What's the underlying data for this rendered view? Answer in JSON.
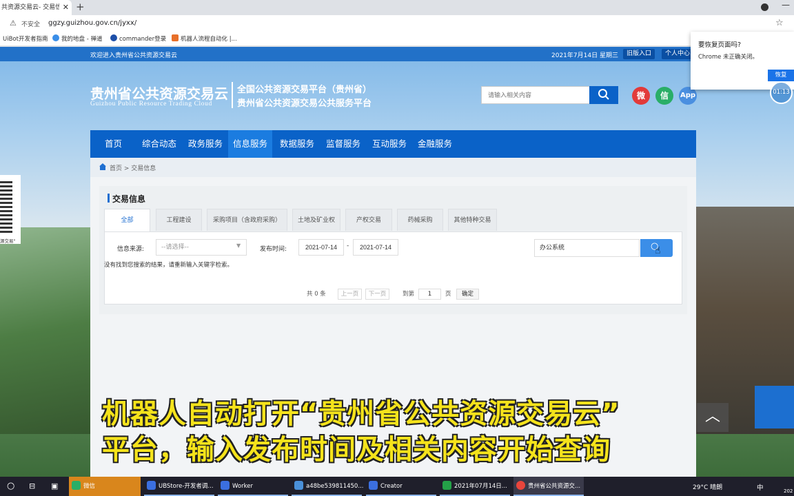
{
  "browser": {
    "tab_title": "共资源交易云- 交易信息",
    "tab_close": "✕",
    "new_tab": "+",
    "minimize": "—",
    "security_label": "不安全",
    "url": "ggzy.guizhou.gov.cn/jyxx/",
    "bookmarks": [
      {
        "label": "UiBot开发者指南",
        "color": "#ffffff"
      },
      {
        "label": "我的地盘 - 禅道",
        "color": "#3a8ee8"
      },
      {
        "label": "commander登录",
        "color": "#1d4fa8"
      },
      {
        "label": "机器人流程自动化 |...",
        "color": "#e8702a"
      }
    ]
  },
  "restore_popup": {
    "title": "要恢复页面吗?",
    "text": "Chrome 未正确关闭。",
    "button": "恢复",
    "timer": "01:13"
  },
  "header": {
    "welcome": "欢迎进入贵州省公共资源交易云",
    "date": "2021年7月14日",
    "weekday": "星期三",
    "old_entry": "旧版入口",
    "personal_center": "个人中心",
    "logo_cn": "贵州省公共资源交易云",
    "logo_en": "Guizhou Public Resource Trading Cloud",
    "platform_line1": "全国公共资源交易平台（贵州省）",
    "platform_line2": "贵州省公共资源交易公共服务平台",
    "search_placeholder": "请输入相关内容",
    "social": {
      "weibo": "微",
      "wechat": "信",
      "app": "App"
    }
  },
  "nav": {
    "items": [
      "首页",
      "综合动态",
      "政务服务",
      "信息服务",
      "数据服务",
      "监督服务",
      "互动服务",
      "金融服务"
    ],
    "active": "信息服务"
  },
  "breadcrumb": "首页 > 交易信息",
  "panel": {
    "title": "交易信息",
    "tabs": [
      "全部",
      "工程建设",
      "采购项目（含政府采购）",
      "土地及矿业权",
      "产权交易",
      "药械采购",
      "其他特种交易"
    ],
    "active_tab": "全部",
    "source_label": "信息来源:",
    "source_value": "--请选择--",
    "date_label": "发布时间:",
    "date_from": "2021-07-14",
    "date_sep": "-",
    "date_to": "2021-07-14",
    "keyword": "办公系统",
    "no_result": "没有找到您搜索的结果，请重新输入关键字检索。",
    "pagination": {
      "total": "共 0 条",
      "prev": "上一页",
      "next": "下一页",
      "goto": "到第",
      "page": "1",
      "page_unit": "页",
      "confirm": "确定"
    }
  },
  "qr": {
    "caption": "源交易\""
  },
  "caption": {
    "line1": "机器人自动打开“贵州省公共资源交易云”",
    "line2": "平台，输入发布时间及相关内容开始查询"
  },
  "taskbar": {
    "items": [
      {
        "label": "微信",
        "color": "#2aae67"
      },
      {
        "label": "UBStore-开发者调...",
        "color": "#3b6fe0"
      },
      {
        "label": "Worker",
        "color": "#3b6fe0"
      },
      {
        "label": "a48be539811450...",
        "color": "#4a90d9"
      },
      {
        "label": "Creator",
        "color": "#3b6fe0"
      },
      {
        "label": "2021年07月14日...",
        "color": "#24a148"
      },
      {
        "label": "贵州省公共资源交...",
        "color": "#e8453c"
      }
    ],
    "weather": "29°C 晴朗",
    "ime": "中",
    "year": "202"
  }
}
